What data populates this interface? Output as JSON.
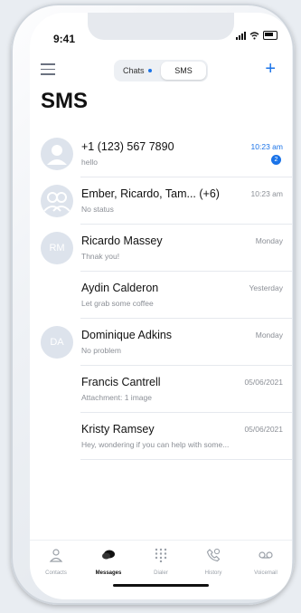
{
  "status_bar": {
    "time": "9:41"
  },
  "header": {
    "segment": {
      "chats_label": "Chats",
      "sms_label": "SMS",
      "selected": "SMS"
    },
    "title": "SMS"
  },
  "conversations": [
    {
      "avatar": "person-icon",
      "initials": "",
      "name": "+1 (123) 567 7890",
      "preview": "hello",
      "time": "10:23 am",
      "unread": "2"
    },
    {
      "avatar": "group-icon",
      "initials": "",
      "name": "Ember, Ricardo, Tam... (+6)",
      "preview": "No status",
      "time": "10:23 am",
      "unread": ""
    },
    {
      "avatar": "initials",
      "initials": "RM",
      "name": "Ricardo Massey",
      "preview": "Thnak you!",
      "time": "Monday",
      "unread": ""
    },
    {
      "avatar": "none",
      "initials": "",
      "name": "Aydin Calderon",
      "preview": "Let grab some coffee",
      "time": "Yesterday",
      "unread": ""
    },
    {
      "avatar": "initials",
      "initials": "DA",
      "name": "Dominique Adkins",
      "preview": "No problem",
      "time": "Monday",
      "unread": ""
    },
    {
      "avatar": "none",
      "initials": "",
      "name": "Francis Cantrell",
      "preview": "Attachment: 1 image",
      "time": "05/06/2021",
      "unread": ""
    },
    {
      "avatar": "none",
      "initials": "",
      "name": "Kristy Ramsey",
      "preview": "Hey, wondering if you can help with some...",
      "time": "05/06/2021",
      "unread": ""
    }
  ],
  "tabbar": {
    "items": [
      {
        "label": "Contacts",
        "icon": "contacts-icon",
        "active": false
      },
      {
        "label": "Messages",
        "icon": "messages-icon",
        "active": true
      },
      {
        "label": "Dialer",
        "icon": "dialpad-icon",
        "active": false
      },
      {
        "label": "History",
        "icon": "history-icon",
        "active": false
      },
      {
        "label": "Voicemail",
        "icon": "voicemail-icon",
        "active": false
      }
    ]
  },
  "colors": {
    "accent": "#1a73e8",
    "avatar_bg": "#dde3ec"
  }
}
